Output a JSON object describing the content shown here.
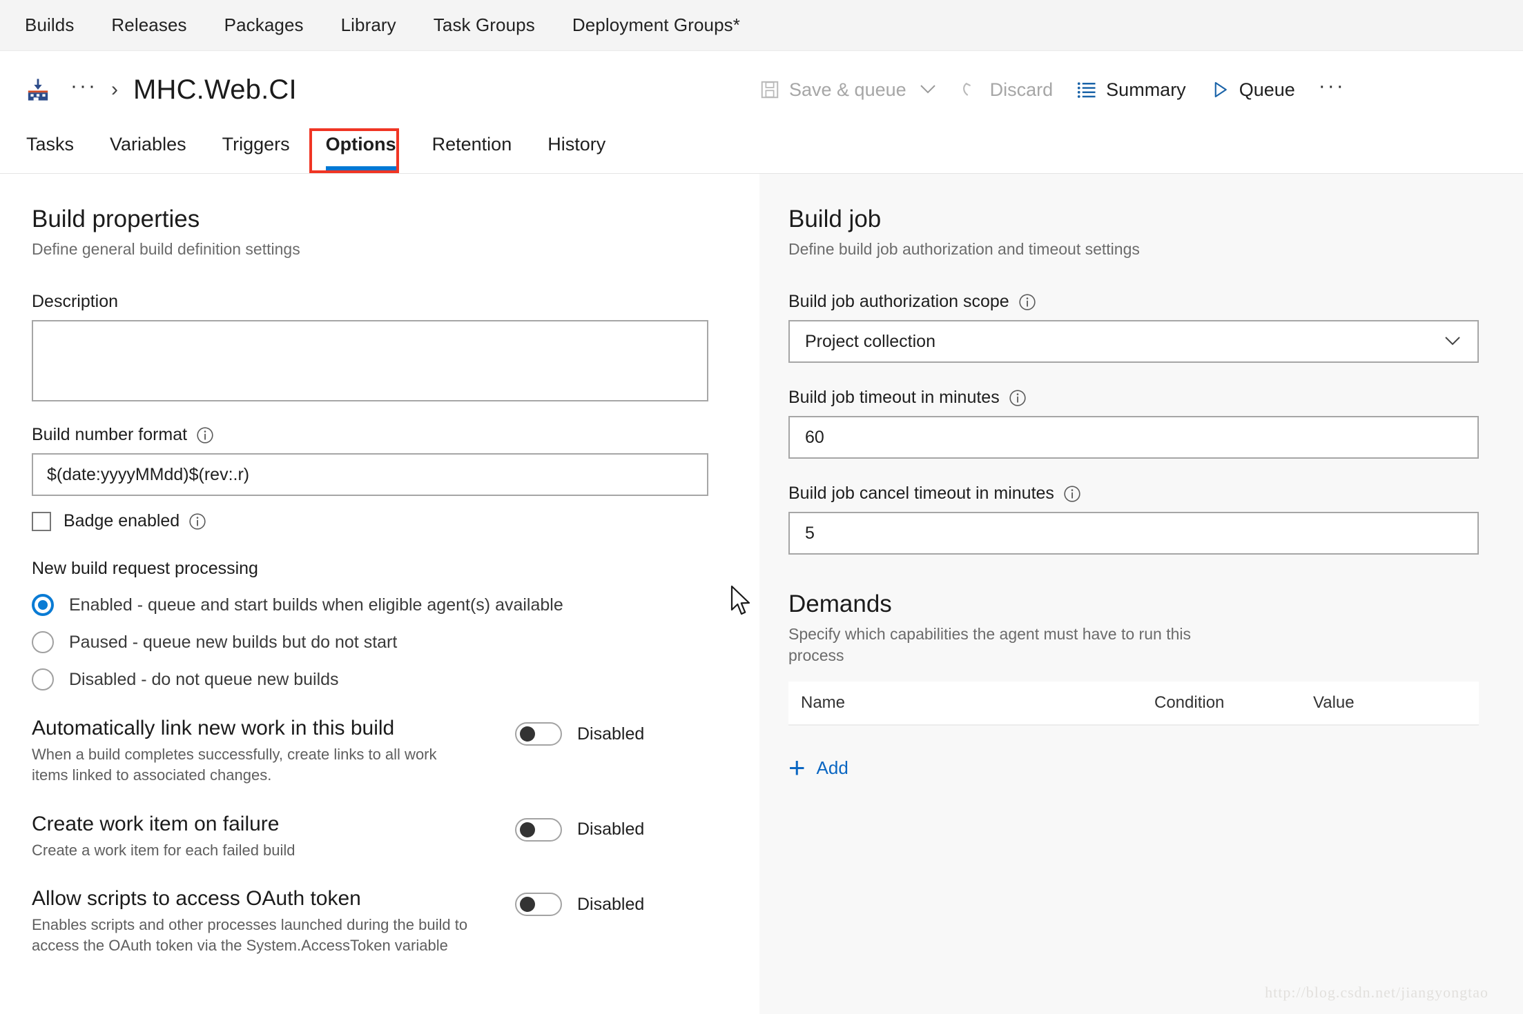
{
  "hub_nav": {
    "items": [
      {
        "label": "Builds"
      },
      {
        "label": "Releases"
      },
      {
        "label": "Packages"
      },
      {
        "label": "Library"
      },
      {
        "label": "Task Groups"
      },
      {
        "label": "Deployment Groups*"
      }
    ]
  },
  "header": {
    "breadcrumb_icon": "build-definition-icon",
    "breadcrumb_ellipsis": "···",
    "breadcrumb_separator": "›",
    "title": "MHC.Web.CI"
  },
  "toolbar": {
    "save_queue_label": "Save & queue",
    "save_queue_caret": "⌄",
    "discard_label": "Discard",
    "summary_label": "Summary",
    "queue_label": "Queue",
    "more_label": "···"
  },
  "tabs": {
    "items": [
      {
        "label": "Tasks",
        "selected": false
      },
      {
        "label": "Variables",
        "selected": false
      },
      {
        "label": "Triggers",
        "selected": false
      },
      {
        "label": "Options",
        "selected": true
      },
      {
        "label": "Retention",
        "selected": false
      },
      {
        "label": "History",
        "selected": false
      }
    ],
    "highlight_color": "#f03524",
    "underline_color": "#0078d4"
  },
  "build_properties": {
    "title": "Build properties",
    "subtitle": "Define general build definition settings",
    "description_label": "Description",
    "description_value": "",
    "build_number_format_label": "Build number format",
    "build_number_format_value": "$(date:yyyyMMdd)$(rev:.r)",
    "badge_enabled_label": "Badge enabled",
    "badge_enabled_checked": false,
    "new_build_request_label": "New build request processing",
    "radio_options": [
      {
        "label": "Enabled - queue and start builds when eligible agent(s) available",
        "checked": true
      },
      {
        "label": "Paused - queue new builds but do not start",
        "checked": false
      },
      {
        "label": "Disabled - do not queue new builds",
        "checked": false
      }
    ],
    "toggles": [
      {
        "heading": "Automatically link new work in this build",
        "description": "When a build completes successfully, create links to all work items linked to associated changes.",
        "state_label": "Disabled",
        "on": false
      },
      {
        "heading": "Create work item on failure",
        "description": "Create a work item for each failed build",
        "state_label": "Disabled",
        "on": false
      },
      {
        "heading": "Allow scripts to access OAuth token",
        "description": "Enables scripts and other processes launched during the build to access the OAuth token via the System.AccessToken variable",
        "state_label": "Disabled",
        "on": false
      }
    ]
  },
  "build_job": {
    "title": "Build job",
    "subtitle": "Define build job authorization and timeout settings",
    "auth_scope_label": "Build job authorization scope",
    "auth_scope_value": "Project collection",
    "timeout_label": "Build job timeout in minutes",
    "timeout_value": "60",
    "cancel_timeout_label": "Build job cancel timeout in minutes",
    "cancel_timeout_value": "5"
  },
  "demands": {
    "title": "Demands",
    "subtitle": "Specify which capabilities the agent must have to run this process",
    "columns": [
      "Name",
      "Condition",
      "Value"
    ],
    "rows": [],
    "add_label": "Add",
    "add_icon": "plus-icon"
  },
  "watermark": {
    "text": "http://blog.csdn.net/jiangyongtao"
  },
  "colors": {
    "accent": "#0078d4",
    "link": "#0a66c2",
    "highlight": "#f03524",
    "panel_bg": "#f8f8f8",
    "nav_bg": "#f4f4f4"
  }
}
